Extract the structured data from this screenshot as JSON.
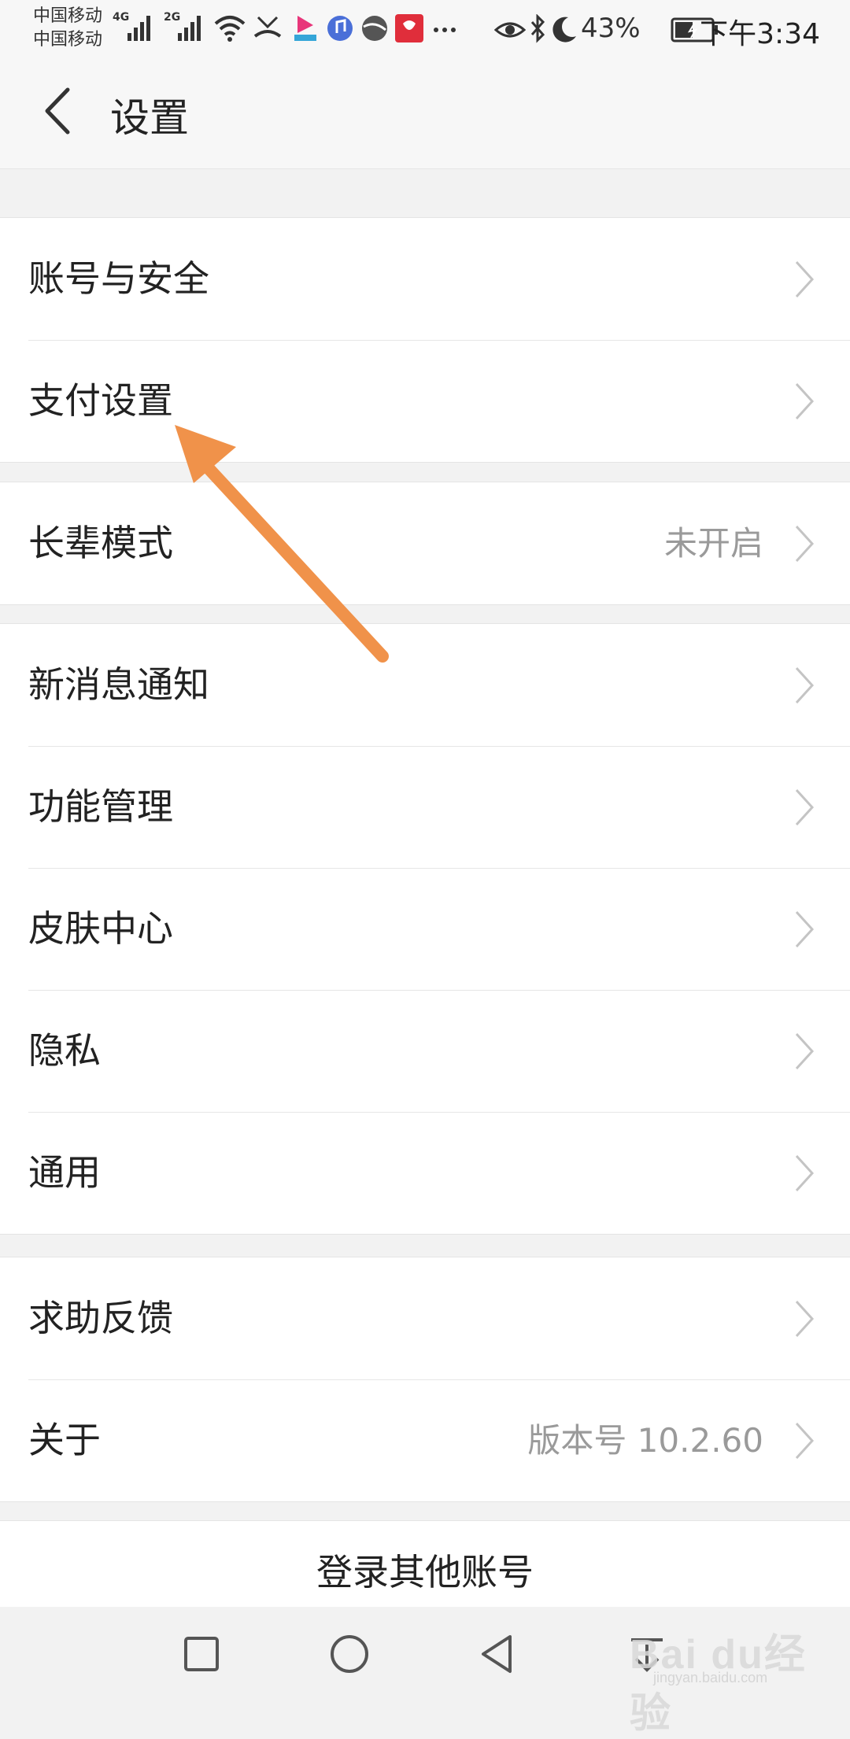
{
  "status_bar": {
    "carrier_1": "中国移动",
    "carrier_2": "中国移动",
    "net_1": "4G",
    "net_2": "2G",
    "battery_percent": "43%",
    "time": "下午3:34"
  },
  "header": {
    "title": "设置"
  },
  "groups": [
    {
      "items": [
        {
          "label": "账号与安全",
          "value": ""
        },
        {
          "label": "支付设置",
          "value": ""
        }
      ]
    },
    {
      "items": [
        {
          "label": "长辈模式",
          "value": "未开启"
        }
      ]
    },
    {
      "items": [
        {
          "label": "新消息通知",
          "value": ""
        },
        {
          "label": "功能管理",
          "value": ""
        },
        {
          "label": "皮肤中心",
          "value": ""
        },
        {
          "label": "隐私",
          "value": ""
        },
        {
          "label": "通用",
          "value": ""
        }
      ]
    },
    {
      "items": [
        {
          "label": "求助反馈",
          "value": ""
        },
        {
          "label": "关于",
          "value": "版本号 10.2.60"
        }
      ]
    }
  ],
  "login_other": "登录其他账号",
  "watermark": {
    "text": "Bai du经验",
    "sub": "jingyan.baidu.com"
  },
  "colors": {
    "annotation_arrow": "#f0924a",
    "background": "#f2f2f2",
    "row_background": "#ffffff",
    "secondary_text": "#9a9a9a"
  },
  "icons": {
    "back": "chevron-left-icon",
    "row_arrow": "chevron-right-icon",
    "nav": [
      "square-recent-icon",
      "circle-home-icon",
      "triangle-back-icon",
      "pull-down-icon"
    ]
  }
}
